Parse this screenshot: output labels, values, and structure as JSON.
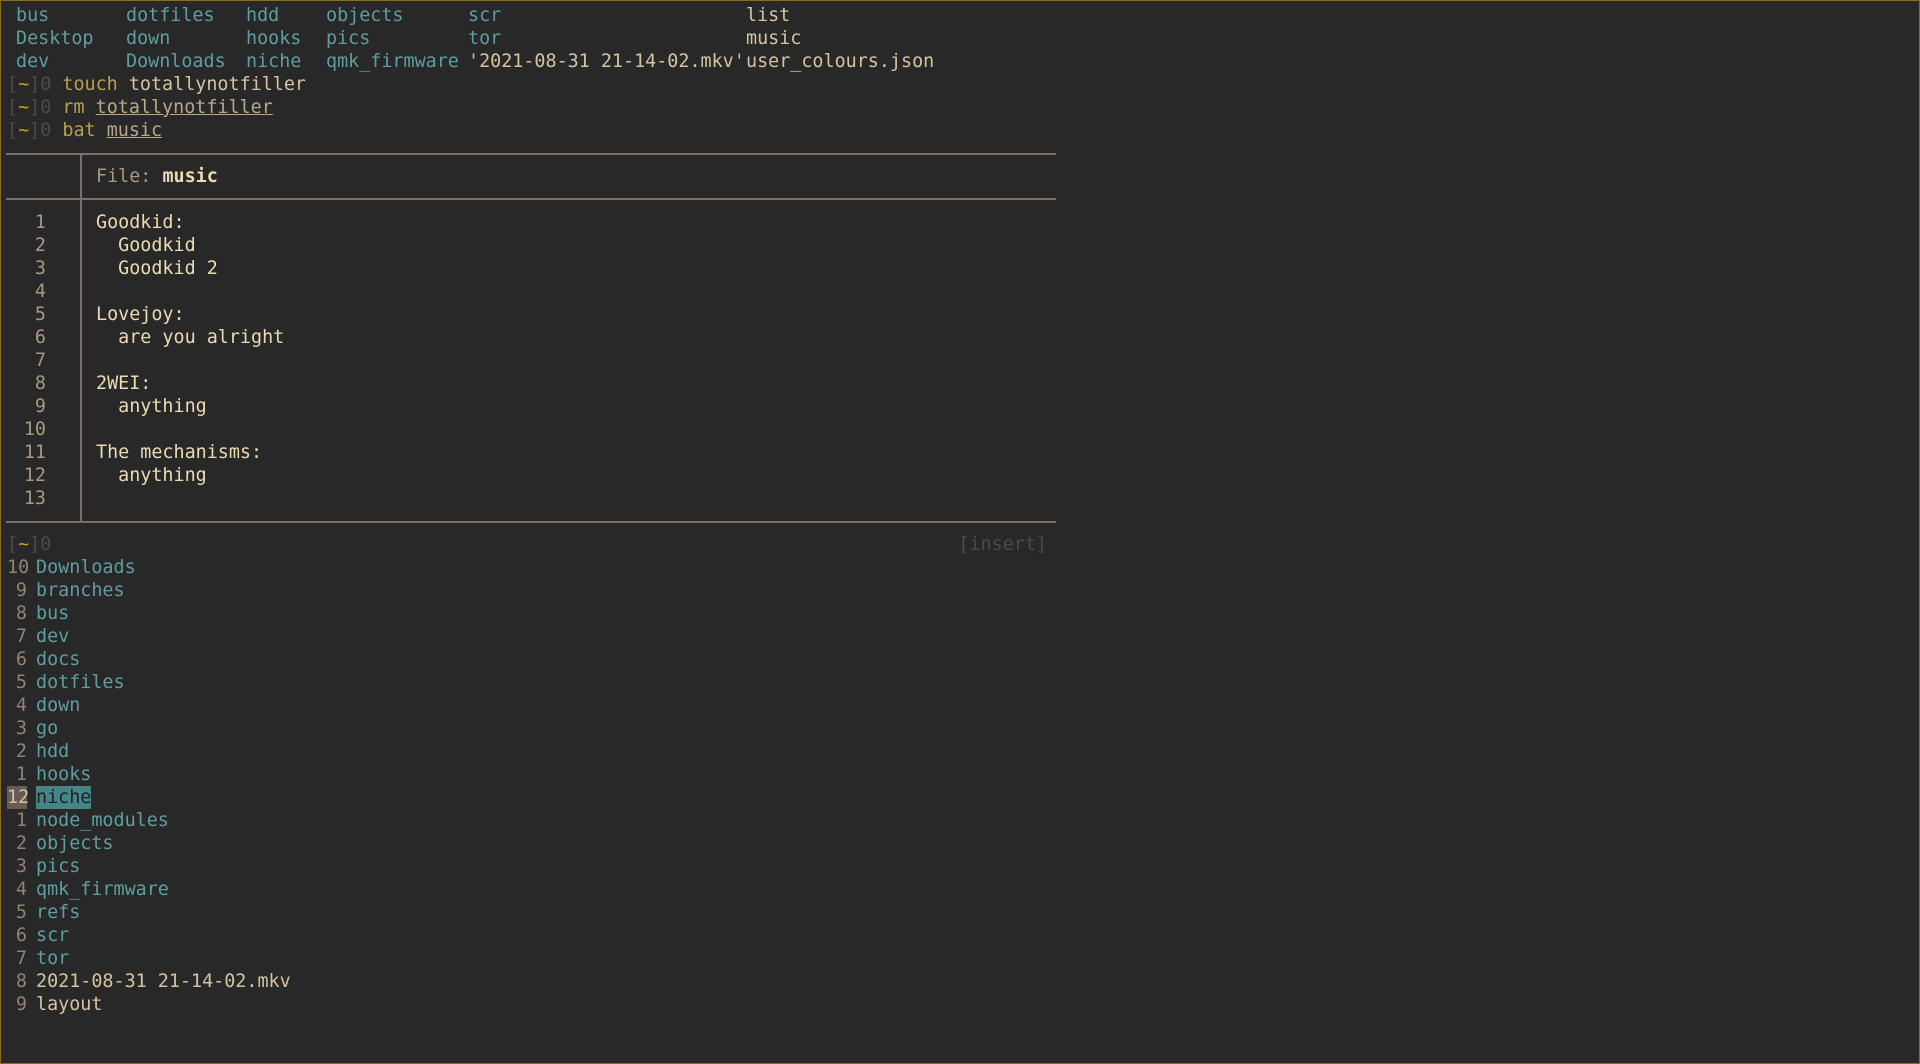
{
  "ls_rows": [
    [
      {
        "text": "bus",
        "kind": "dir"
      },
      {
        "text": "dotfiles",
        "kind": "dir"
      },
      {
        "text": "hdd",
        "kind": "dir"
      },
      {
        "text": "objects",
        "kind": "dir"
      },
      {
        "text": "scr",
        "kind": "dir"
      },
      {
        "text": "list",
        "kind": "file"
      }
    ],
    [
      {
        "text": "Desktop",
        "kind": "dir"
      },
      {
        "text": "down",
        "kind": "dir"
      },
      {
        "text": "hooks",
        "kind": "dir"
      },
      {
        "text": "pics",
        "kind": "dir"
      },
      {
        "text": "tor",
        "kind": "dir"
      },
      {
        "text": "music",
        "kind": "file"
      }
    ],
    [
      {
        "text": "dev",
        "kind": "dir"
      },
      {
        "text": "Downloads",
        "kind": "dir"
      },
      {
        "text": "niche",
        "kind": "dir"
      },
      {
        "text": "qmk_firmware",
        "kind": "dir"
      },
      {
        "text": "'2021-08-31 21-14-02.mkv'",
        "kind": "file"
      },
      {
        "text": "user_colours.json",
        "kind": "file"
      }
    ]
  ],
  "prompt": {
    "open": "[",
    "dir": "~",
    "close": "]",
    "status": "0"
  },
  "commands": [
    {
      "cmd": "touch",
      "arg": "totallynotfiller",
      "underline": false
    },
    {
      "cmd": "rm",
      "arg": "totallynotfiller",
      "underline": true
    },
    {
      "cmd": "bat",
      "arg": "music",
      "underline": true
    }
  ],
  "bat": {
    "file_label": "File:",
    "file_name": "music",
    "lines": [
      {
        "n": "1",
        "text": "Goodkid:"
      },
      {
        "n": "2",
        "text": "  Goodkid"
      },
      {
        "n": "3",
        "text": "  Goodkid 2"
      },
      {
        "n": "4",
        "text": ""
      },
      {
        "n": "5",
        "text": "Lovejoy:"
      },
      {
        "n": "6",
        "text": "  are you alright"
      },
      {
        "n": "7",
        "text": ""
      },
      {
        "n": "8",
        "text": "2WEI:"
      },
      {
        "n": "9",
        "text": "  anything"
      },
      {
        "n": "10",
        "text": ""
      },
      {
        "n": "11",
        "text": "The mechanisms:"
      },
      {
        "n": "12",
        "text": "  anything"
      },
      {
        "n": "13",
        "text": ""
      }
    ]
  },
  "mode_indicator": "[insert]",
  "menu_items": [
    {
      "count": "10",
      "path": "Downloads",
      "kind": "dir"
    },
    {
      "count": "9",
      "path": "branches",
      "kind": "dir"
    },
    {
      "count": "8",
      "path": "bus",
      "kind": "dir"
    },
    {
      "count": "7",
      "path": "dev",
      "kind": "dir"
    },
    {
      "count": "6",
      "path": "docs",
      "kind": "dir"
    },
    {
      "count": "5",
      "path": "dotfiles",
      "kind": "dir"
    },
    {
      "count": "4",
      "path": "down",
      "kind": "dir"
    },
    {
      "count": "3",
      "path": "go",
      "kind": "dir"
    },
    {
      "count": "2",
      "path": "hdd",
      "kind": "dir"
    },
    {
      "count": "1",
      "path": "hooks",
      "kind": "dir"
    },
    {
      "count": "12",
      "path": "niche",
      "kind": "dir",
      "selected": true
    },
    {
      "count": "1",
      "path": "node_modules",
      "kind": "dir"
    },
    {
      "count": "2",
      "path": "objects",
      "kind": "dir"
    },
    {
      "count": "3",
      "path": "pics",
      "kind": "dir"
    },
    {
      "count": "4",
      "path": "qmk_firmware",
      "kind": "dir"
    },
    {
      "count": "5",
      "path": "refs",
      "kind": "dir"
    },
    {
      "count": "6",
      "path": "scr",
      "kind": "dir"
    },
    {
      "count": "7",
      "path": "tor",
      "kind": "dir"
    },
    {
      "count": "8",
      "path": "2021-08-31 21-14-02.mkv",
      "kind": "file"
    },
    {
      "count": "9",
      "path": "layout",
      "kind": "file"
    }
  ],
  "colors": {
    "background": "#282828",
    "directory": "#5f9ea0",
    "file": "#d5c4a1",
    "prompt_dir": "#d79921",
    "command": "#b9a04a",
    "selection": "#458588"
  }
}
